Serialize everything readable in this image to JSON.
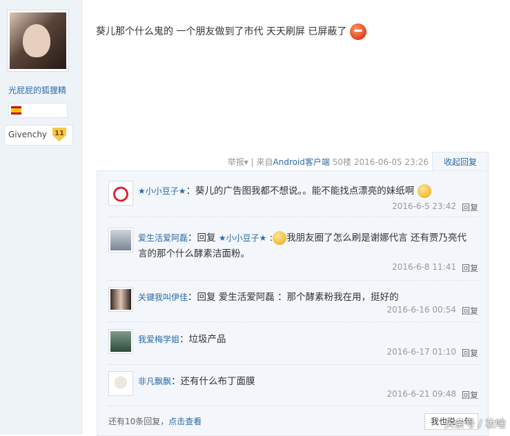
{
  "author": {
    "username": "光屁屁的狐狸精",
    "country_flag": "spain-flag",
    "brand": "Givenchy",
    "level": "11"
  },
  "post": {
    "text": "葵儿那个什么鬼的 一个朋友做到了市代 天天刷屏 已屏蔽了",
    "emoji": "angry-face-emoji",
    "meta": {
      "report": "举报",
      "from_prefix": "来自",
      "source": "Android客户端",
      "floor": "50楼",
      "datetime": "2016-06-05 23:26"
    },
    "collapse_label": "收起回复"
  },
  "replies": [
    {
      "name": "★小小豆子★",
      "text": "葵儿的广告图我都不想说。。能不能找点漂亮的妹纸啊",
      "emoji": "smirk-emoji",
      "date": "2016-6-5 23:42",
      "reply_label": "回复"
    },
    {
      "name": "爱生活爱阿磊",
      "reply_prefix": "回复",
      "reply_to": "★小小豆子★",
      "text": "我朋友圈了怎么刷是谢娜代言 还有贾乃亮代言的那个什么酵素洁面粉。",
      "emoji": "grin-emoji",
      "date": "2016-6-8 11:41",
      "reply_label": "回复"
    },
    {
      "name": "关键我叫伊佳",
      "text": "回复 爱生活爱阿磊 ：那个酵素粉我在用，挺好的",
      "date": "2016-6-16 00:54",
      "reply_label": "回复"
    },
    {
      "name": "我爱梅学姐",
      "text": "垃圾产品",
      "date": "2016-6-17 01:10",
      "reply_label": "回复"
    },
    {
      "name": "非凡飘飘",
      "text": "还有什么布丁面膜",
      "date": "2016-6-21 09:48",
      "reply_label": "回复"
    }
  ],
  "footer": {
    "more_text": "还有10条回复，",
    "more_link": "点击查看",
    "say_button": "我也说一句"
  },
  "watermark": "头条号 / 妆啥",
  "colors": {
    "link": "#2b6aa8",
    "meta": "#999999",
    "reply_bg": "#f3f6fa"
  }
}
